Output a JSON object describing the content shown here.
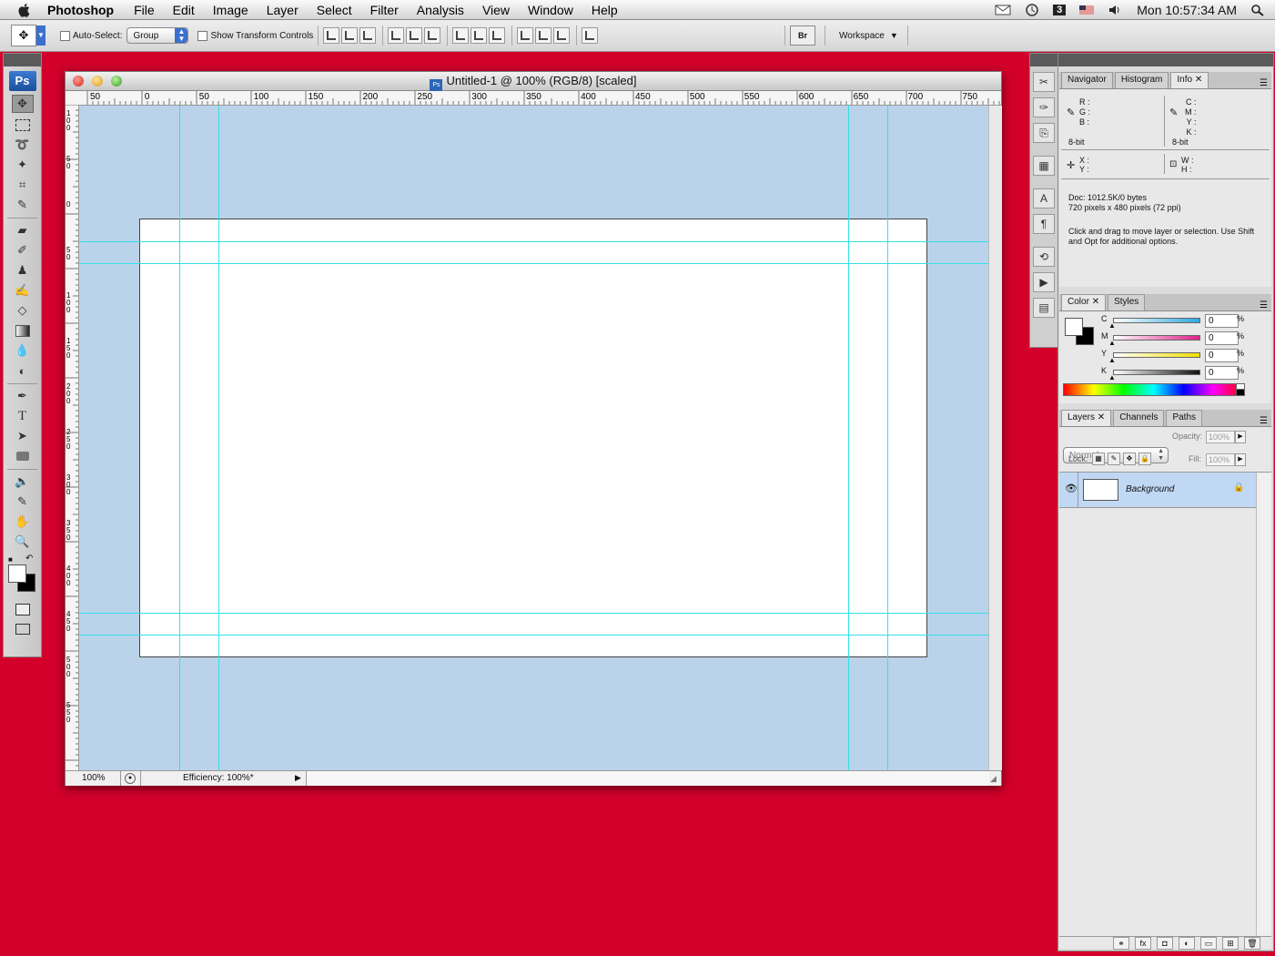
{
  "menubar": {
    "app_name": "Photoshop",
    "items": [
      "File",
      "Edit",
      "Image",
      "Layer",
      "Select",
      "Filter",
      "Analysis",
      "View",
      "Window",
      "Help"
    ],
    "clock": "Mon 10:57:34 AM",
    "status_badge": "3"
  },
  "options_bar": {
    "auto_select_label": "Auto-Select:",
    "auto_select_value": "Group",
    "show_transform_label": "Show Transform Controls",
    "workspace_label": "Workspace",
    "bridge_label": "Br"
  },
  "tools": {
    "logo": "Ps"
  },
  "document": {
    "title": "Untitled-1 @ 100% (RGB/8) [scaled]",
    "ruler_labels": [
      "50",
      "0",
      "50",
      "100",
      "150",
      "200",
      "250",
      "300",
      "350",
      "400",
      "450",
      "500",
      "550",
      "600",
      "650",
      "700",
      "750"
    ],
    "vertical_ruler_labels": [
      "100",
      "50",
      "0",
      "50",
      "100",
      "150",
      "200",
      "250",
      "300",
      "350",
      "400",
      "450",
      "500",
      "550"
    ],
    "zoom": "100%",
    "status": "Efficiency: 100%*"
  },
  "info_panel": {
    "tabs": [
      "Navigator",
      "Histogram",
      "Info"
    ],
    "active_tab": "Info",
    "rgb_labels": [
      "R :",
      "G :",
      "B :"
    ],
    "cmyk_labels": [
      "C :",
      "M :",
      "Y :",
      "K :"
    ],
    "bit_left": "8-bit",
    "bit_right": "8-bit",
    "xy_labels": [
      "X :",
      "Y :"
    ],
    "wh_labels": [
      "W :",
      "H :"
    ],
    "doc_size": "Doc: 1012.5K/0 bytes",
    "dimensions": "720 pixels x 480 pixels (72 ppi)",
    "hint": "Click and drag to move layer or selection.  Use Shift and Opt for additional options."
  },
  "color_panel": {
    "tabs": [
      "Color",
      "Styles"
    ],
    "active_tab": "Color",
    "channels": [
      {
        "label": "C",
        "value": "0",
        "gradient": "#2ea8e0"
      },
      {
        "label": "M",
        "value": "0",
        "gradient": "#e0208a"
      },
      {
        "label": "Y",
        "value": "0",
        "gradient": "#f0e000"
      },
      {
        "label": "K",
        "value": "0",
        "gradient": "#111111"
      }
    ],
    "percent": "%"
  },
  "layers_panel": {
    "tabs": [
      "Layers",
      "Channels",
      "Paths"
    ],
    "active_tab": "Layers",
    "blend_mode": "Normal",
    "opacity_label": "Opacity:",
    "opacity_value": "100%",
    "lock_label": "Lock:",
    "fill_label": "Fill:",
    "fill_value": "100%",
    "layers": [
      {
        "name": "Background",
        "locked": true,
        "visible": true
      }
    ],
    "footer_icons": [
      "link-icon",
      "fx-icon",
      "mask-icon",
      "adjustment-icon",
      "folder-icon",
      "new-layer-icon",
      "trash-icon"
    ]
  },
  "colors": {
    "desktop": "#d2002b",
    "pasteboard": "#bad3ea",
    "guide": "#33e0e8",
    "layer_highlight": "#c0d8f4"
  }
}
